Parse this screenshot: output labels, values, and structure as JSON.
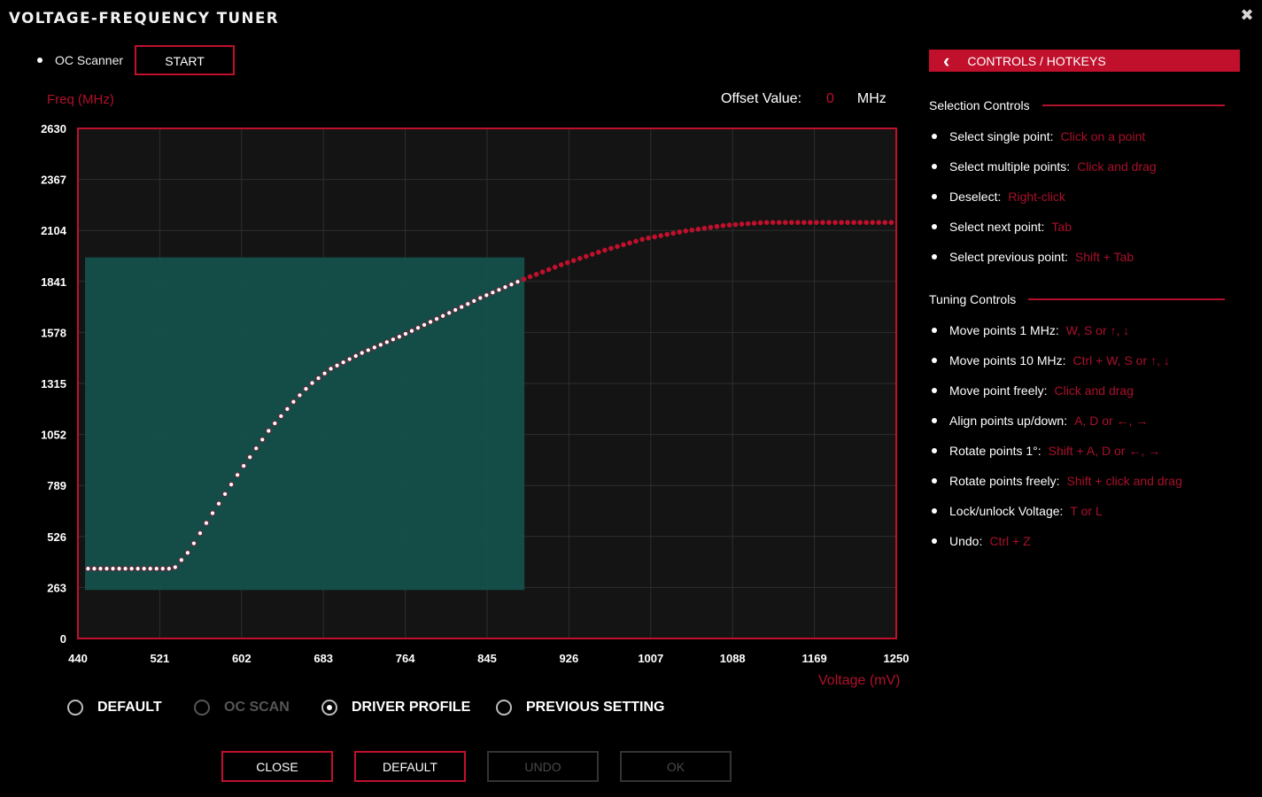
{
  "window": {
    "title": "VOLTAGE-FREQUENCY TUNER",
    "close_glyph": "✖"
  },
  "oc_scanner": {
    "label": "OC Scanner",
    "start_label": "START"
  },
  "offset": {
    "label": "Offset Value:",
    "value": "0",
    "unit": "MHz"
  },
  "colors": {
    "accent": "#c0102c",
    "selection": "#14524c",
    "background": "#000000",
    "plot_bg": "#141414"
  },
  "chart_data": {
    "type": "scatter",
    "ylabel": "Freq (MHz)",
    "xlabel": "Voltage (mV)",
    "xlim": [
      440,
      1250
    ],
    "ylim": [
      0,
      2630
    ],
    "x_ticks": [
      "440",
      "521",
      "602",
      "683",
      "764",
      "845",
      "926",
      "1007",
      "1088",
      "1169",
      "1250"
    ],
    "y_ticks": [
      "0",
      "263",
      "526",
      "789",
      "1052",
      "1315",
      "1578",
      "1841",
      "2104",
      "2367",
      "2630"
    ],
    "grid": true,
    "selection_region": {
      "x": [
        447,
        882
      ],
      "y": [
        250,
        1965
      ]
    },
    "curve": [
      [
        450,
        360
      ],
      [
        535,
        360
      ],
      [
        550,
        450
      ],
      [
        570,
        620
      ],
      [
        600,
        860
      ],
      [
        630,
        1080
      ],
      [
        655,
        1230
      ],
      [
        670,
        1310
      ],
      [
        690,
        1390
      ],
      [
        720,
        1470
      ],
      [
        760,
        1560
      ],
      [
        800,
        1660
      ],
      [
        840,
        1760
      ],
      [
        880,
        1850
      ],
      [
        920,
        1930
      ],
      [
        960,
        2000
      ],
      [
        1000,
        2060
      ],
      [
        1040,
        2100
      ],
      [
        1080,
        2130
      ],
      [
        1120,
        2145
      ],
      [
        1250,
        2145
      ]
    ],
    "point_count": 130,
    "selected_max_voltage": 881
  },
  "profiles": {
    "options": [
      {
        "label": "DEFAULT",
        "selected": false,
        "disabled": false
      },
      {
        "label": "OC SCAN",
        "selected": false,
        "disabled": true
      },
      {
        "label": "DRIVER PROFILE",
        "selected": true,
        "disabled": false
      },
      {
        "label": "PREVIOUS SETTING",
        "selected": false,
        "disabled": false
      }
    ]
  },
  "buttons": {
    "close": "CLOSE",
    "default": "DEFAULT",
    "undo": "UNDO",
    "ok": "OK"
  },
  "controls": {
    "header": "CONTROLS / HOTKEYS",
    "chevron": "‹",
    "selection_title": "Selection Controls",
    "selection": [
      {
        "label": "Select single point:",
        "key": "Click on a point"
      },
      {
        "label": "Select multiple points:",
        "key": "Click and drag"
      },
      {
        "label": "Deselect:",
        "key": "Right-click"
      },
      {
        "label": "Select next point:",
        "key": "Tab"
      },
      {
        "label": "Select previous point:",
        "key": "Shift + Tab"
      }
    ],
    "tuning_title": "Tuning Controls",
    "tuning": [
      {
        "label": "Move points 1 MHz:",
        "key": "W, S or ↑, ↓"
      },
      {
        "label": "Move points 10 MHz:",
        "key": "Ctrl + W, S or ↑, ↓"
      },
      {
        "label": "Move point freely:",
        "key": "Click and drag"
      },
      {
        "label": "Align points up/down:",
        "key": "A, D or ←, →"
      },
      {
        "label": "Rotate points 1°:",
        "key": "Shift + A, D or ←, →"
      },
      {
        "label": "Rotate points freely:",
        "key": "Shift + click and drag"
      },
      {
        "label": "Lock/unlock Voltage:",
        "key": "T or L"
      },
      {
        "label": "Undo:",
        "key": "Ctrl + Z"
      }
    ]
  }
}
